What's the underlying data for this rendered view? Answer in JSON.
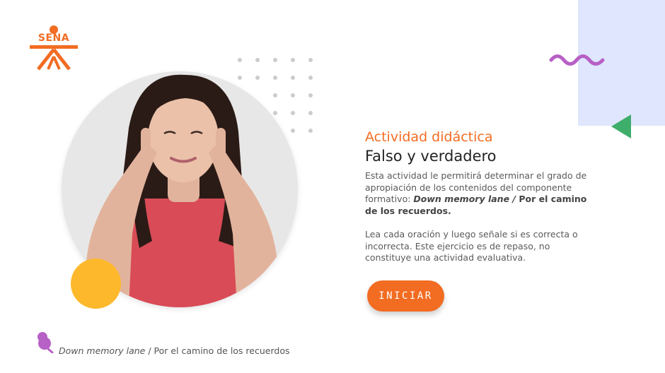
{
  "logo": {
    "text": "SENA"
  },
  "content": {
    "subtitle": "Actividad didáctica",
    "title": "Falso y verdadero",
    "description": {
      "intro": "Esta actividad le permitirá determinar el grado de apropiación de los contenidos del componente formativo: ",
      "course_italic": "Down memory lane / ",
      "course_bold": "Por el camino de los recuerdos."
    },
    "instructions": "Lea cada oración y luego señale si es correcta o incorrecta.  Este ejercicio es de repaso, no constituye una actividad evaluativa."
  },
  "button": {
    "label": "INICIAR"
  },
  "footer": {
    "course_italic": "Down memory lane",
    "course_rest": " /  Por el camino de los recuerdos"
  },
  "colors": {
    "accent": "#f26c22",
    "yellow": "#fdb82c",
    "panel": "#dfe6fd",
    "wave": "#b760c6",
    "triangle": "#3fae6b"
  },
  "icons": [
    "sena-logo-icon",
    "wave-decoration-icon",
    "triangle-decoration-icon",
    "thumbtack-icon"
  ]
}
